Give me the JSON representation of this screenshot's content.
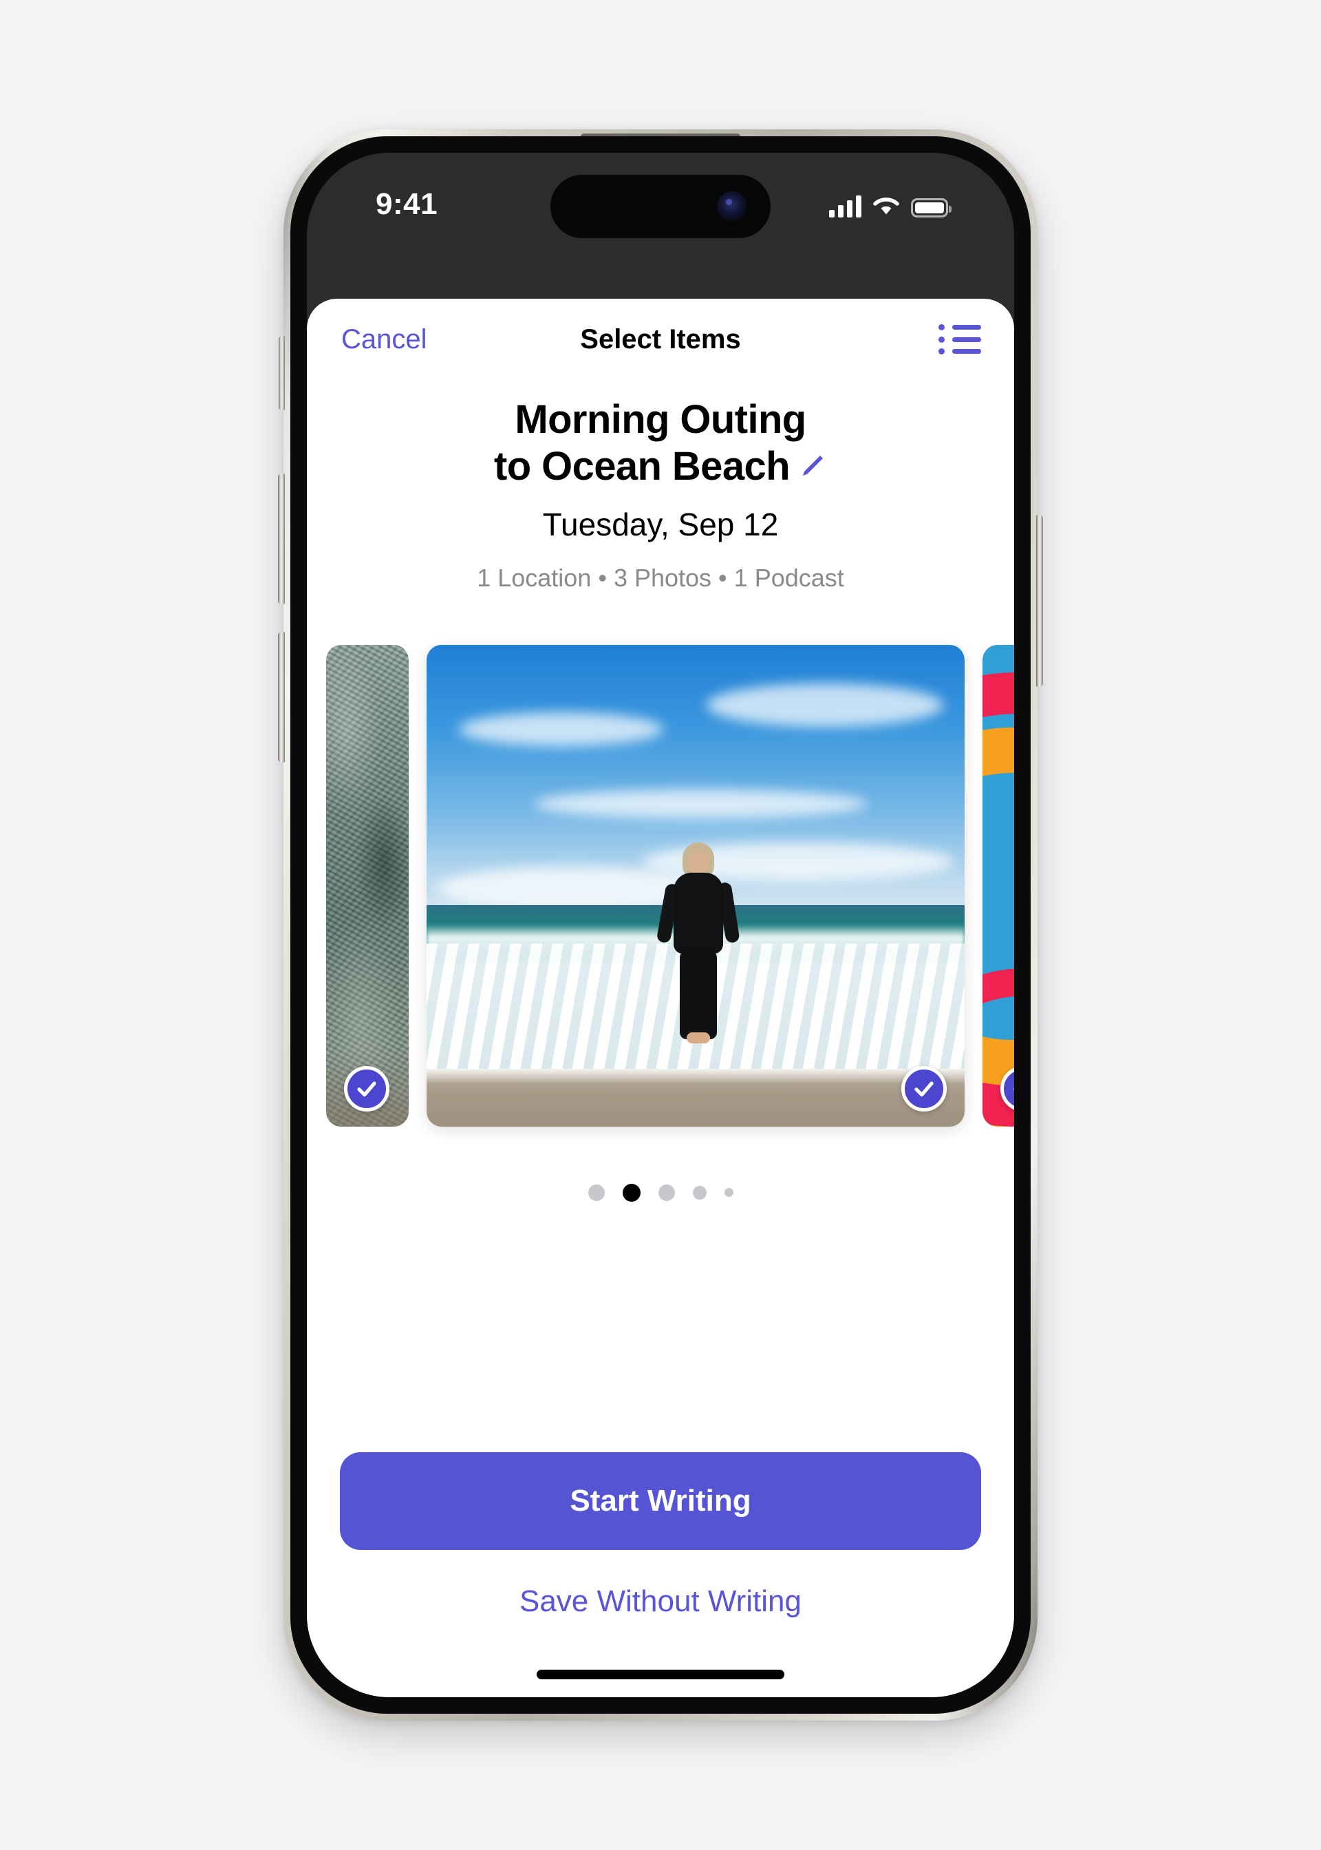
{
  "status_bar": {
    "time": "9:41",
    "cellular_icon": "signal-bars-icon",
    "wifi_icon": "wifi-icon",
    "battery_icon": "battery-full-icon"
  },
  "navbar": {
    "cancel_label": "Cancel",
    "title": "Select Items",
    "list_view_icon": "bulleted-list-icon"
  },
  "header": {
    "title_line1": "Morning Outing",
    "title_line2": "to Ocean Beach",
    "edit_icon": "pencil-icon",
    "date": "Tuesday, Sep 12",
    "meta": "1 Location • 3 Photos • 1 Podcast",
    "meta_parts": [
      "1 Location",
      "3 Photos",
      "1 Podcast"
    ]
  },
  "carousel": {
    "cards": [
      {
        "name": "photo-rock-texture",
        "type": "photo",
        "selected": true,
        "position": "left-partial"
      },
      {
        "name": "photo-beach-runner",
        "type": "photo",
        "selected": true,
        "position": "center"
      },
      {
        "name": "podcast-artwork",
        "type": "podcast",
        "selected": true,
        "position": "right-partial"
      }
    ],
    "page_dots": {
      "count": 5,
      "active_index": 1
    }
  },
  "footer": {
    "primary_label": "Start Writing",
    "secondary_label": "Save Without Writing"
  },
  "colors": {
    "accent_purple": "#5454D4",
    "link_purple": "#5A54D6",
    "check_badge": "#4B45CF",
    "meta_gray": "#8A8A8E",
    "dot_inactive": "#C7C7CC",
    "dot_active": "#000000",
    "sheet_bg": "#FFFFFF",
    "screen_bg": "#2C2C2C",
    "page_bg": "#F5F5F7"
  }
}
